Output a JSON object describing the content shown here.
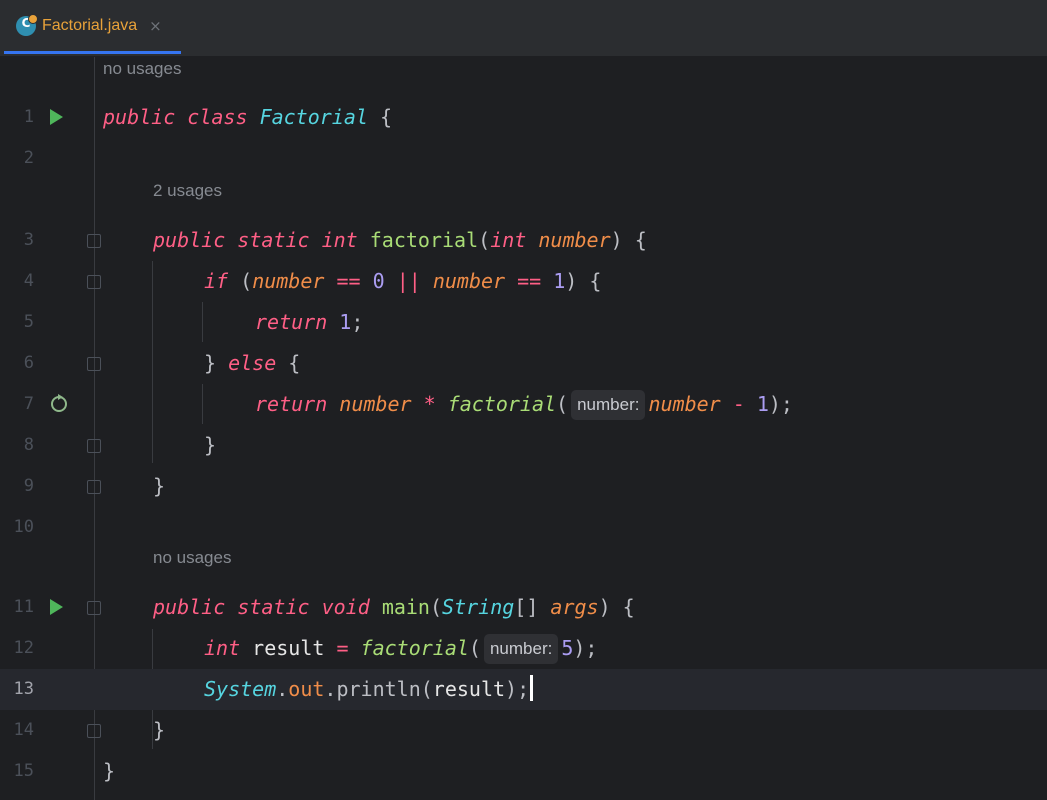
{
  "tab": {
    "file_name": "Factorial.java",
    "close_glyph": "×",
    "icon_letter": "C"
  },
  "hints": {
    "class_usages": "no usages",
    "factorial_usages": "2 usages",
    "main_usages": "no usages",
    "param_hint": "number:"
  },
  "line_numbers": [
    "1",
    "2",
    "3",
    "4",
    "5",
    "6",
    "7",
    "8",
    "9",
    "10",
    "11",
    "12",
    "13",
    "14",
    "15"
  ],
  "code": {
    "l1": {
      "kw1": "public",
      "kw2": "class",
      "cls": "Factorial",
      "rest": " {"
    },
    "l3": {
      "kw1": "public",
      "kw2": "static",
      "kw3": "int",
      "fn": "factorial",
      "p1": "(",
      "kw4": "int",
      "prm": "number",
      "p2": ") {"
    },
    "l4": {
      "kw": "if",
      "p1": " (",
      "v1": "number",
      "op1": " == ",
      "n1": "0",
      "op2": " || ",
      "v2": "number",
      "op3": " == ",
      "n2": "1",
      "p2": ") {"
    },
    "l5": {
      "kw": "return",
      "n": "1",
      "p": ";"
    },
    "l6": {
      "p1": "} ",
      "kw": "else",
      "p2": " {"
    },
    "l7": {
      "kw": "return",
      "v1": "number",
      "op1": " * ",
      "fn": "factorial",
      "p1": "(",
      "v2": "number",
      "op2": " - ",
      "n": "1",
      "p2": ");"
    },
    "l8": {
      "p": "}"
    },
    "l9": {
      "p": "}"
    },
    "l11": {
      "kw1": "public",
      "kw2": "static",
      "kw3": "void",
      "fn": "main",
      "p1": "(",
      "cls": "String",
      "p2": "[] ",
      "prm": "args",
      "p3": ") {"
    },
    "l12": {
      "kw": "int",
      "var": "result",
      "op": " = ",
      "fn": "factorial",
      "p1": "(",
      "n": "5",
      "p2": ");"
    },
    "l13": {
      "cls": "System",
      "p1": ".",
      "fld": "out",
      "p2": ".println(",
      "var": "result",
      "p3": ");"
    },
    "l14": {
      "p": "}"
    },
    "l15": {
      "p": "}"
    }
  },
  "colors": {
    "background": "#1e1f22",
    "keyword": "#ff5f86",
    "class": "#56d5e0",
    "function": "#a9dc76",
    "parameter": "#f08d49",
    "number": "#ab9df2",
    "run_icon": "#4fb65b"
  },
  "icons": {
    "run": "run-triangle-icon",
    "fold": "fold-marker-icon",
    "recursion": "recursive-call-icon",
    "file": "java-class-file-icon"
  }
}
